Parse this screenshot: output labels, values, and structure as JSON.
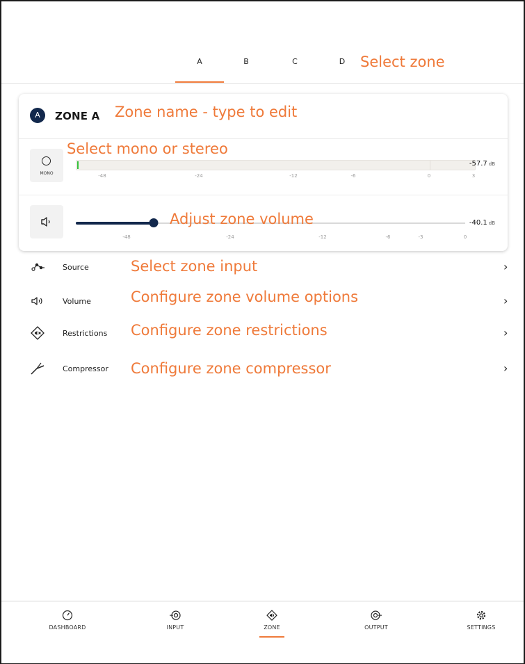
{
  "zone_tabs": [
    {
      "label": "A",
      "active": true
    },
    {
      "label": "B",
      "active": false
    },
    {
      "label": "C",
      "active": false
    },
    {
      "label": "D",
      "active": false
    }
  ],
  "zone": {
    "badge": "A",
    "name": "ZONE A"
  },
  "meter": {
    "mode_label": "MONO",
    "ticks": [
      "-48",
      "-24",
      "-12",
      "-6",
      "0",
      "3"
    ],
    "level_db": "-57.7",
    "unit": "dB"
  },
  "volume": {
    "ticks": [
      "-48",
      "-24",
      "-12",
      "-6",
      "-3",
      "0"
    ],
    "value_db": "-40.1",
    "unit": "dB",
    "level_fraction": 0.2
  },
  "menu": [
    {
      "label": "Source",
      "icon": "source-icon"
    },
    {
      "label": "Volume",
      "icon": "speaker-icon"
    },
    {
      "label": "Restrictions",
      "icon": "restrictions-icon"
    },
    {
      "label": "Compressor",
      "icon": "compressor-icon"
    }
  ],
  "bottom_nav": [
    {
      "label": "DASHBOARD",
      "icon": "gauge-icon",
      "active": false
    },
    {
      "label": "INPUT",
      "icon": "input-icon",
      "active": false
    },
    {
      "label": "ZONE",
      "icon": "zone-icon",
      "active": true
    },
    {
      "label": "OUTPUT",
      "icon": "output-icon",
      "active": false
    },
    {
      "label": "SETTINGS",
      "icon": "gear-icon",
      "active": false
    }
  ],
  "annotations": {
    "select_zone": "Select zone",
    "zone_name": "Zone name - type to edit",
    "mono_stereo": "Select mono or stereo",
    "zone_volume": "Adjust zone volume",
    "zone_input": "Select zone input",
    "volume_options": "Configure zone volume options",
    "restrictions": "Configure zone restrictions",
    "compressor": "Configure zone compressor"
  },
  "colors": {
    "accent": "#ef7a3a",
    "navy": "#12284c",
    "meter_green": "#36c23c"
  }
}
